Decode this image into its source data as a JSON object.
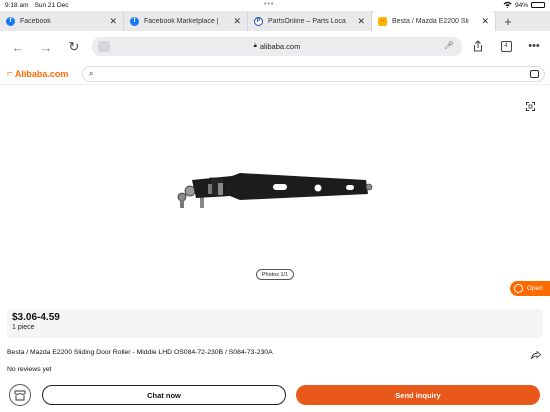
{
  "status": {
    "time": "9:18 am",
    "date": "Sun 21 Dec",
    "battery": "94%",
    "battery_level": 0.94
  },
  "tabs": [
    {
      "label": "Facebook",
      "icon": "facebook-icon",
      "active": false
    },
    {
      "label": "Facebook Marketplace |",
      "icon": "facebook-icon",
      "active": false
    },
    {
      "label": "PartsOnline – Parts Loca",
      "icon": "partsonline-icon",
      "active": false
    },
    {
      "label": "Besta / Mazda E2200 Sli",
      "icon": "alibaba-icon",
      "active": true
    }
  ],
  "browser": {
    "url": "alibaba.com",
    "tab_count": "4"
  },
  "site": {
    "logo": "Alibaba.com",
    "brand_color": "#ff6a00"
  },
  "gallery": {
    "photo_counter": "Photos 1/1"
  },
  "floating": {
    "open_label": "Open"
  },
  "product": {
    "price": "$3.06-4.59",
    "moq": "1 piece",
    "title": "Besta / Mazda E2200 Sliding Door Roller - Middle LHD OS084-72-230B / S084-73-230A",
    "reviews": "No reviews yet"
  },
  "actions": {
    "chat_label": "Chat now",
    "inquiry_label": "Send inquiry",
    "inquiry_color": "#e8581a"
  }
}
